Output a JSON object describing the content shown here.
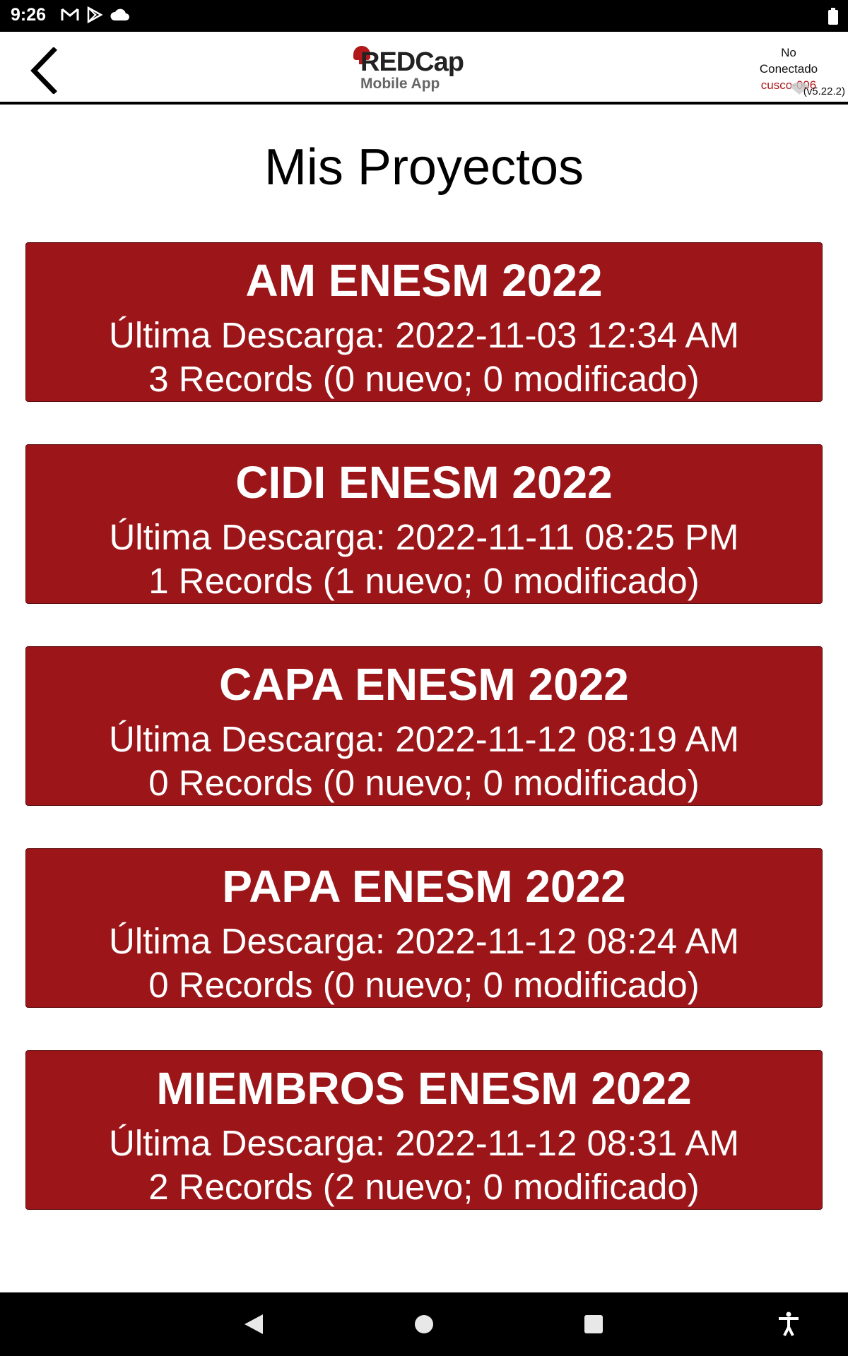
{
  "status_bar": {
    "time": "9:26",
    "icons": [
      "gmail-icon",
      "play-store-icon",
      "cloud-icon"
    ],
    "battery": "battery-icon"
  },
  "header": {
    "back_icon": "chevron-left-icon",
    "logo": {
      "main": "REDCap",
      "sub": "Mobile App"
    },
    "connection": {
      "line1": "No",
      "line2": "Conectado",
      "user": "cusco-006",
      "version": "(v5.22.2)"
    }
  },
  "page_title": "Mis Proyectos",
  "projects": [
    {
      "title": "AM ENESM 2022",
      "download": "Última Descarga: 2022-11-03 12:34 AM",
      "records": "3 Records (0 nuevo; 0 modificado)"
    },
    {
      "title": "CIDI ENESM 2022",
      "download": "Última Descarga: 2022-11-11 08:25 PM",
      "records": "1 Records (1 nuevo; 0 modificado)"
    },
    {
      "title": "CAPA ENESM 2022",
      "download": "Última Descarga: 2022-11-12 08:19 AM",
      "records": "0 Records (0 nuevo; 0 modificado)"
    },
    {
      "title": "PAPA ENESM 2022",
      "download": "Última Descarga: 2022-11-12 08:24 AM",
      "records": "0 Records (0 nuevo; 0 modificado)"
    },
    {
      "title": "MIEMBROS ENESM 2022",
      "download": "Última Descarga: 2022-11-12 08:31 AM",
      "records": "2 Records (2 nuevo; 0 modificado)"
    }
  ],
  "colors": {
    "card_bg": "#9c1619",
    "brand_red": "#b1181b"
  },
  "nav_bar": {
    "icons": [
      "back-triangle-icon",
      "home-circle-icon",
      "recents-square-icon",
      "accessibility-icon"
    ]
  }
}
